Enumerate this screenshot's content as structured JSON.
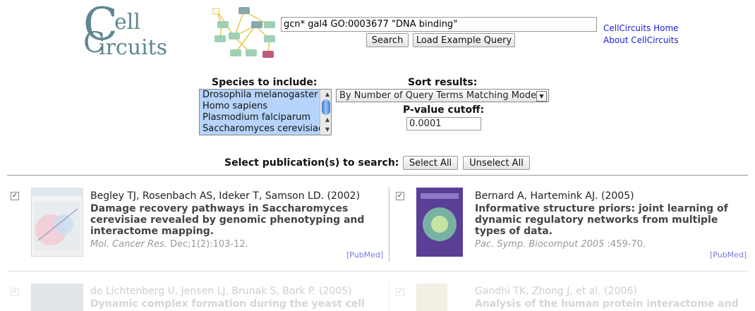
{
  "logo": {
    "c1": "C",
    "ell": "ell",
    "c2": "C",
    "ircuits": "ircuits"
  },
  "search": {
    "query": "gcn* gal4 GO:0003677 \"DNA binding\"",
    "search_label": "Search",
    "example_label": "Load Example Query"
  },
  "links": {
    "home": "CellCircuits Home",
    "about": "About CellCircuits"
  },
  "options": {
    "species_label": "Species to include:",
    "species": [
      "Drosophila melanogaster",
      "Homo sapiens",
      "Plasmodium falciparum",
      "Saccharomyces cerevisiae"
    ],
    "sort_label": "Sort results:",
    "sort_value": "By Number of Query Terms Matching Model",
    "pvalue_label": "P-value cutoff:",
    "pvalue": "0.0001"
  },
  "publications_bar": {
    "label": "Select publication(s) to search:",
    "select_all": "Select All",
    "unselect_all": "Unselect All"
  },
  "publications": [
    {
      "authors": "Begley TJ, Rosenbach AS, Ideker T, Samson LD. (2002)",
      "title": "Damage recovery pathways in Saccharomyces cerevisiae revealed by genomic phenotyping and interactome mapping.",
      "journal_name": "Mol. Cancer Res.",
      "journal_detail": " Dec;1(2):103-12.",
      "pubmed": "[PubMed]",
      "checked": "✓"
    },
    {
      "authors": "Bernard A, Hartemink AJ. (2005)",
      "title": "Informative structure priors: joint learning of dynamic regulatory networks from multiple types of data.",
      "journal_name": "Pac. Symp. Biocomput 2005",
      "journal_detail": " :459-70.",
      "pubmed": "[PubMed]",
      "checked": "✓"
    },
    {
      "authors": "de Lichtenberg U, Jensen LJ, Brunak S, Bork P. (2005)",
      "title": "Dynamic complex formation during the yeast cell",
      "checked": "✓"
    },
    {
      "authors": "Gandhi TK, Zhong J, et al. (2006)",
      "title": "Analysis of the human protein interactome and",
      "checked": "✓"
    }
  ],
  "colors": {
    "logo_teal": "#5f8793",
    "link_blue": "#1a1adb",
    "selection": "#b6d4fb"
  }
}
